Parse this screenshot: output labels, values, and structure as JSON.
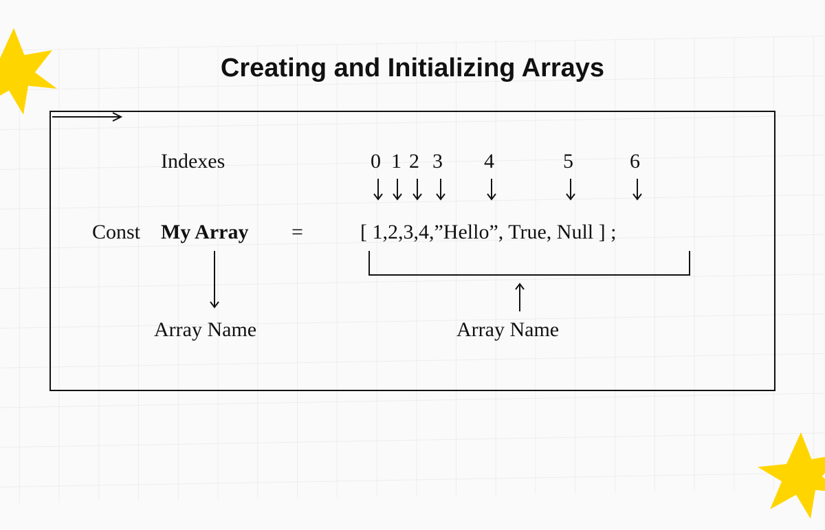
{
  "title": "Creating and Initializing Arrays",
  "diagram": {
    "indexes_label": "Indexes",
    "indexes": {
      "0": "0",
      "1": "1",
      "2": "2",
      "3": "3",
      "4": "4",
      "5": "5",
      "6": "6"
    },
    "const_kw": "Const",
    "array_name": "My Array",
    "equals": "=",
    "array_literal": "[ 1,2,3,4,”Hello”, True, Null ] ;",
    "label_array_name_1": "Array Name",
    "label_array_name_2": "Array Name"
  },
  "decor": {
    "star_color": "#FFD500"
  }
}
